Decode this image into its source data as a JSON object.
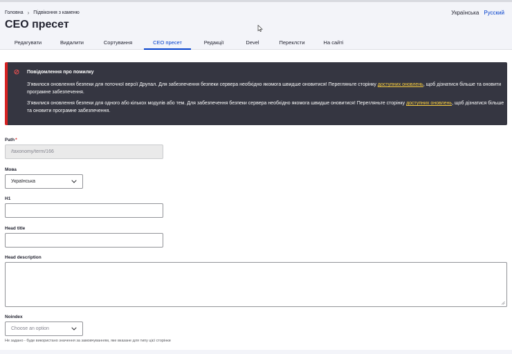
{
  "breadcrumb": {
    "home": "Головна",
    "separator": "›",
    "current": "Підвіконня з каменю"
  },
  "language_switcher": {
    "current": "Українська",
    "other": "Русский"
  },
  "page_title": "СЕО пресет",
  "tabs": [
    {
      "label": "Редагувати"
    },
    {
      "label": "Видалити"
    },
    {
      "label": "Сортування"
    },
    {
      "label": "СЕО пресет",
      "active": true
    },
    {
      "label": "Редакції"
    },
    {
      "label": "Devel"
    },
    {
      "label": "Переклсти"
    },
    {
      "label": "На сайті"
    }
  ],
  "alert": {
    "title": "Повідомлення про помилку",
    "message1_before": "З'явилося оновлення безпеки для поточної версії Друпал. Для забезпечення безпеки сервера необхідно якомога швидше оновитися! Перегляньте сторінку ",
    "message1_link": "доступних оновлень",
    "message1_after": ", щоб дізнатися більше та оновити програмне забезпечення.",
    "message2_before": "З'явилися оновлення безпеки для одного або кількох модулів або тем. Для забезпечення безпеки сервера необхідно якомога швидше оновитися! Перегляньте сторінку ",
    "message2_link": "доступних оновлень",
    "message2_after": ", щоб дізнатися більше та оновити програмне забезпечення.",
    "accent_color": "#d72222"
  },
  "form": {
    "path": {
      "label": "Path",
      "required_mark": "*",
      "value": "/taxonomy/term/166"
    },
    "language": {
      "label": "Мова",
      "value": "Українська"
    },
    "h1": {
      "label": "H1",
      "value": ""
    },
    "head_title": {
      "label": "Head title",
      "value": ""
    },
    "head_description": {
      "label": "Head description",
      "value": ""
    },
    "noindex": {
      "label": "Noindex",
      "placeholder": "Choose an option",
      "help": "Не задано - буде використано значення за замовчуванням, яке вказане для типу цієї сторінки"
    }
  },
  "colors": {
    "accent": "#003ecc",
    "alert_bg": "#353641",
    "link_in_alert": "#ffd23f"
  }
}
